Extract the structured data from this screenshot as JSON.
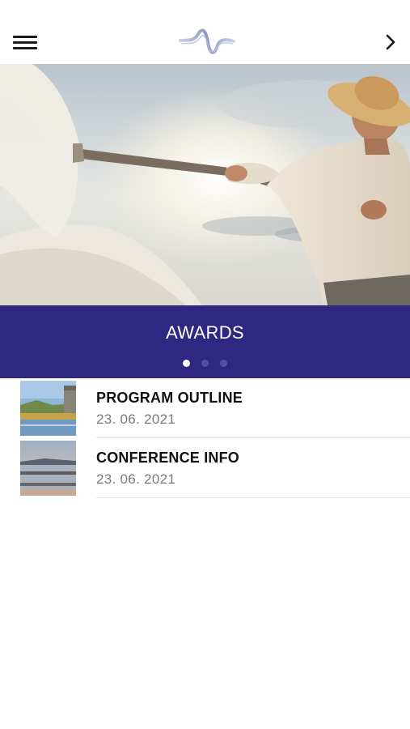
{
  "header": {
    "menu_icon": "hamburger-menu-icon",
    "logo_icon": "wave-logo-icon",
    "next_icon": "chevron-right-icon"
  },
  "hero": {
    "image": "salt-worker-photo",
    "title": "AWARDS",
    "pager": {
      "count": 3,
      "active": 0
    }
  },
  "articles": [
    {
      "title": "PROGRAM OUTLINE",
      "date": "23. 06. 2021",
      "thumb": "salt-pans-building-photo"
    },
    {
      "title": "CONFERENCE INFO",
      "date": "23. 06. 2021",
      "thumb": "salt-pans-sunset-photo"
    }
  ],
  "colors": {
    "banner": "#302782",
    "dot_active": "#ffffff",
    "dot_inactive": "#55509c",
    "date_text": "#7a7a7a"
  }
}
